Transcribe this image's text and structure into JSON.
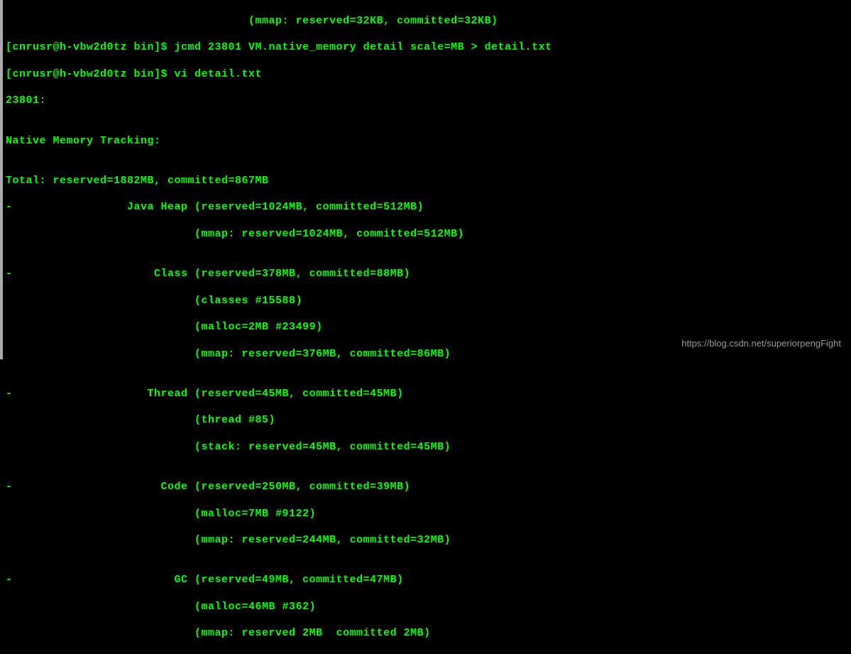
{
  "terminal": {
    "lines": [
      "                                    (mmap: reserved=32KB, committed=32KB)",
      "[cnrusr@h-vbw2d0tz bin]$ jcmd 23801 VM.native_memory detail scale=MB > detail.txt",
      "[cnrusr@h-vbw2d0tz bin]$ vi detail.txt",
      "23801:",
      "",
      "Native Memory Tracking:",
      "",
      "Total: reserved=1882MB, committed=867MB",
      "-                 Java Heap (reserved=1024MB, committed=512MB)",
      "                            (mmap: reserved=1024MB, committed=512MB)",
      "",
      "-                     Class (reserved=378MB, committed=88MB)",
      "                            (classes #15588)",
      "                            (malloc=2MB #23499)",
      "                            (mmap: reserved=376MB, committed=86MB)",
      "",
      "-                    Thread (reserved=45MB, committed=45MB)",
      "                            (thread #85)",
      "                            (stack: reserved=45MB, committed=45MB)",
      "",
      "-                      Code (reserved=250MB, committed=39MB)",
      "                            (malloc=7MB #9122)",
      "                            (mmap: reserved=244MB, committed=32MB)",
      "",
      "-                        GC (reserved=49MB, committed=47MB)",
      "                            (malloc=46MB #362)",
      "                            (mmap: reserved 2MB  committed 2MB)"
    ]
  },
  "watermark": {
    "text": "https://blog.csdn.net/superiorpengFight"
  },
  "chart_data": {
    "type": "table",
    "title": "Native Memory Tracking",
    "process_id": 23801,
    "total": {
      "reserved_mb": 1882,
      "committed_mb": 867
    },
    "categories": [
      {
        "name": "Java Heap",
        "reserved_mb": 1024,
        "committed_mb": 512,
        "details": {
          "mmap": {
            "reserved_mb": 1024,
            "committed_mb": 512
          }
        }
      },
      {
        "name": "Class",
        "reserved_mb": 378,
        "committed_mb": 88,
        "details": {
          "classes_count": 15588,
          "malloc_mb": 2,
          "malloc_count": 23499,
          "mmap": {
            "reserved_mb": 376,
            "committed_mb": 86
          }
        }
      },
      {
        "name": "Thread",
        "reserved_mb": 45,
        "committed_mb": 45,
        "details": {
          "thread_count": 85,
          "stack": {
            "reserved_mb": 45,
            "committed_mb": 45
          }
        }
      },
      {
        "name": "Code",
        "reserved_mb": 250,
        "committed_mb": 39,
        "details": {
          "malloc_mb": 7,
          "malloc_count": 9122,
          "mmap": {
            "reserved_mb": 244,
            "committed_mb": 32
          }
        }
      },
      {
        "name": "GC",
        "reserved_mb": 49,
        "committed_mb": 47,
        "details": {
          "malloc_mb": 46,
          "malloc_count": 362
        }
      }
    ],
    "commands": [
      "jcmd 23801 VM.native_memory detail scale=MB > detail.txt",
      "vi detail.txt"
    ],
    "prompt": "[cnrusr@h-vbw2d0tz bin]$"
  }
}
